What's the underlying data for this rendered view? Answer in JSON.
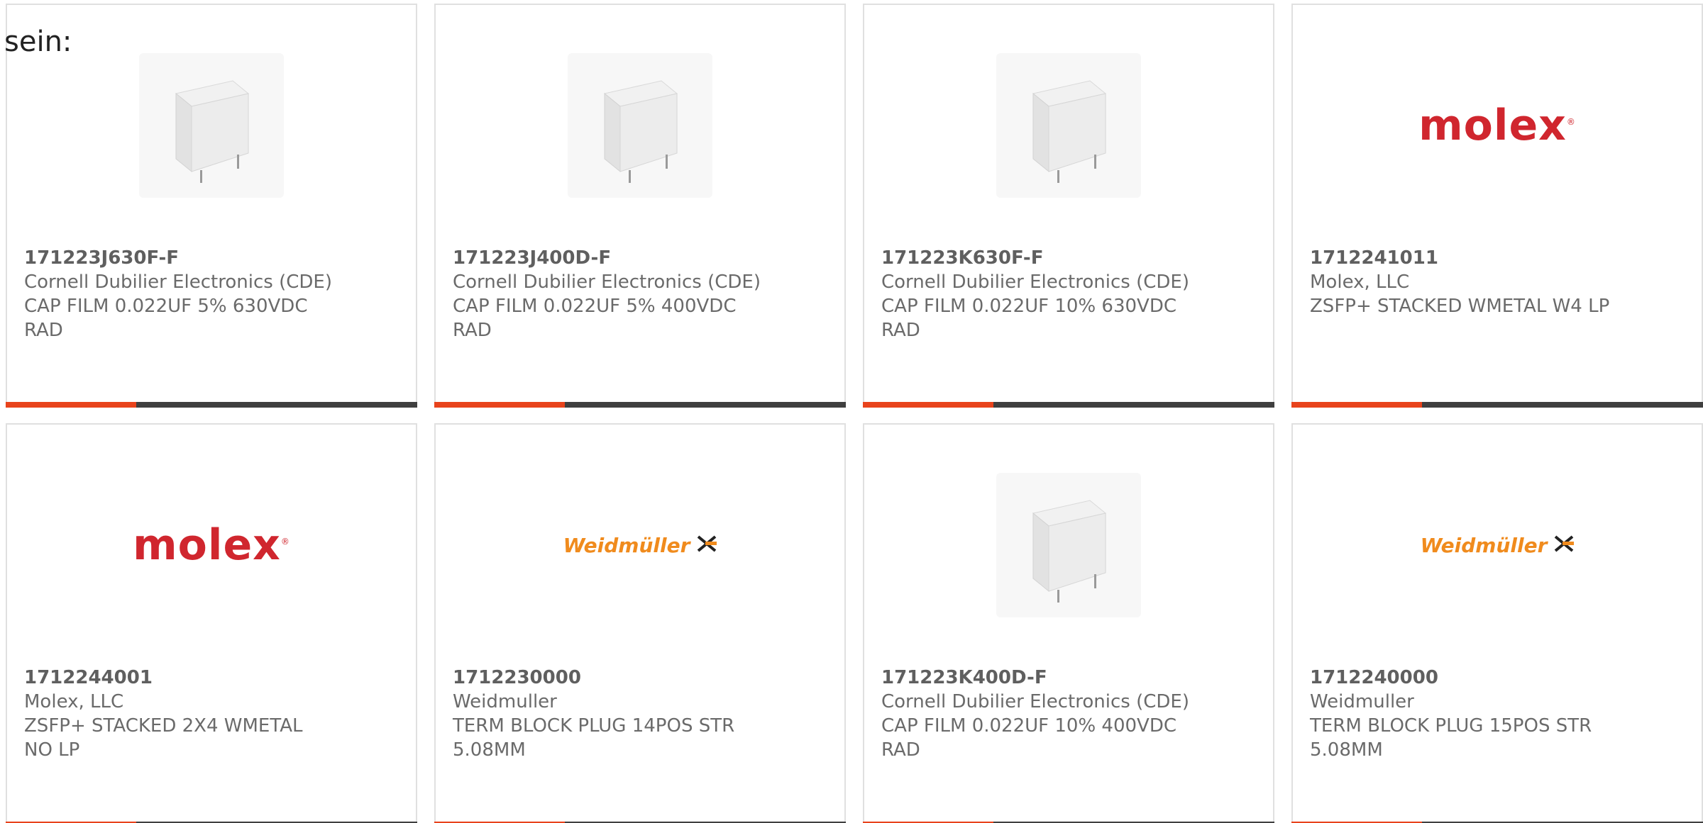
{
  "overlay_label": "sein:",
  "colors": {
    "accent_bar": "#e8431c",
    "bar_dark": "#3f3f3f",
    "molex_red": "#d0262e",
    "weidmuller_orange": "#f08b1d"
  },
  "products": [
    {
      "part_number": "171223J630F-F",
      "manufacturer": "Cornell Dubilier Electronics (CDE)",
      "desc_line1": "CAP FILM 0.022UF 5% 630VDC",
      "desc_line2": "RAD",
      "image": "capacitor-photo"
    },
    {
      "part_number": "171223J400D-F",
      "manufacturer": "Cornell Dubilier Electronics (CDE)",
      "desc_line1": "CAP FILM 0.022UF 5% 400VDC",
      "desc_line2": "RAD",
      "image": "capacitor-photo"
    },
    {
      "part_number": "171223K630F-F",
      "manufacturer": "Cornell Dubilier Electronics (CDE)",
      "desc_line1": "CAP FILM 0.022UF 10% 630VDC",
      "desc_line2": "RAD",
      "image": "capacitor-photo"
    },
    {
      "part_number": "1712241011",
      "manufacturer": "Molex, LLC",
      "desc_line1": "ZSFP+ STACKED WMETAL W4 LP",
      "desc_line2": "",
      "image": "molex-logo",
      "logo_text": "molex"
    },
    {
      "part_number": "1712244001",
      "manufacturer": "Molex, LLC",
      "desc_line1": "ZSFP+ STACKED 2X4 WMETAL",
      "desc_line2": "NO LP",
      "image": "molex-logo",
      "logo_text": "molex"
    },
    {
      "part_number": "1712230000",
      "manufacturer": "Weidmuller",
      "desc_line1": "TERM BLOCK PLUG 14POS STR",
      "desc_line2": "5.08MM",
      "image": "weidmuller-logo",
      "logo_text": "Weidmüller"
    },
    {
      "part_number": "171223K400D-F",
      "manufacturer": "Cornell Dubilier Electronics (CDE)",
      "desc_line1": "CAP FILM 0.022UF 10% 400VDC",
      "desc_line2": "RAD",
      "image": "capacitor-photo"
    },
    {
      "part_number": "1712240000",
      "manufacturer": "Weidmuller",
      "desc_line1": "TERM BLOCK PLUG 15POS STR",
      "desc_line2": "5.08MM",
      "image": "weidmuller-logo",
      "logo_text": "Weidmüller"
    }
  ]
}
